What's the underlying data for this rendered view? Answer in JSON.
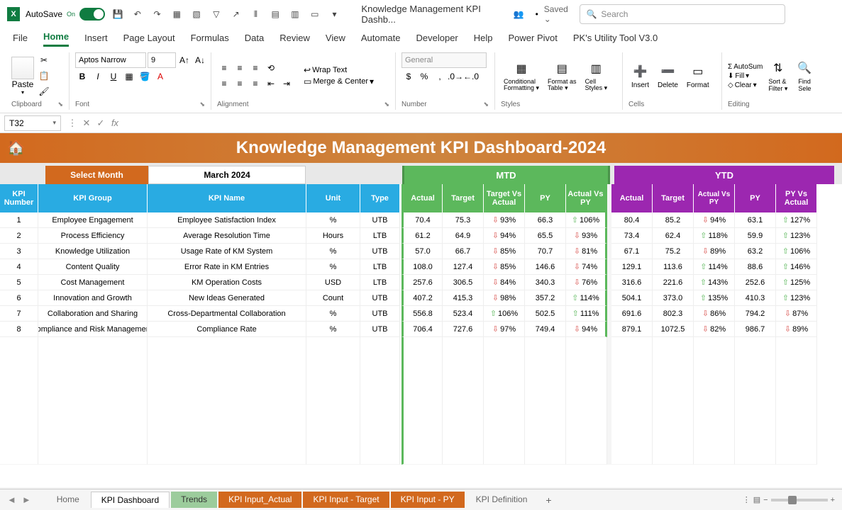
{
  "titlebar": {
    "autosave_label": "AutoSave",
    "autosave_state": "On",
    "doc_title": "Knowledge Management KPI Dashb...",
    "saved_status": "Saved",
    "search_placeholder": "Search"
  },
  "menu": {
    "tabs": [
      "File",
      "Home",
      "Insert",
      "Page Layout",
      "Formulas",
      "Data",
      "Review",
      "View",
      "Automate",
      "Developer",
      "Help",
      "Power Pivot",
      "PK's Utility Tool V3.0"
    ],
    "active": "Home"
  },
  "ribbon": {
    "clipboard": {
      "label": "Clipboard",
      "paste": "Paste"
    },
    "font": {
      "label": "Font",
      "name": "Aptos Narrow",
      "size": "9"
    },
    "alignment": {
      "label": "Alignment",
      "wrap": "Wrap Text",
      "merge": "Merge & Center"
    },
    "number": {
      "label": "Number",
      "format": "General"
    },
    "styles": {
      "label": "Styles",
      "cond": "Conditional Formatting",
      "table": "Format as Table",
      "cell": "Cell Styles"
    },
    "cells": {
      "label": "Cells",
      "insert": "Insert",
      "delete": "Delete",
      "format": "Format"
    },
    "editing": {
      "label": "Editing",
      "autosum": "AutoSum",
      "fill": "Fill",
      "clear": "Clear",
      "sort": "Sort & Filter",
      "find": "Find Sele"
    }
  },
  "formula_bar": {
    "cell_ref": "T32",
    "formula": ""
  },
  "dashboard": {
    "title": "Knowledge Management KPI Dashboard-2024",
    "select_month_label": "Select Month",
    "month_value": "March 2024",
    "mtd_label": "MTD",
    "ytd_label": "YTD",
    "headers": {
      "kpi_num": "KPI Number",
      "kpi_group": "KPI Group",
      "kpi_name": "KPI Name",
      "unit": "Unit",
      "type": "Type",
      "actual": "Actual",
      "target": "Target",
      "tva": "Target Vs Actual",
      "py": "PY",
      "avp": "Actual Vs PY",
      "pva": "PY Vs Actual"
    },
    "rows": [
      {
        "num": "1",
        "group": "Employee Engagement",
        "name": "Employee Satisfaction Index",
        "unit": "%",
        "type": "UTB",
        "m_actual": "70.4",
        "m_target": "75.3",
        "m_tva": "93%",
        "m_tva_dir": "down",
        "m_py": "66.3",
        "m_avp": "106%",
        "m_avp_dir": "up",
        "y_actual": "80.4",
        "y_target": "85.2",
        "y_tva": "94%",
        "y_tva_dir": "down",
        "y_py": "63.1",
        "y_pva": "127%",
        "y_pva_dir": "up"
      },
      {
        "num": "2",
        "group": "Process Efficiency",
        "name": "Average Resolution Time",
        "unit": "Hours",
        "type": "LTB",
        "m_actual": "61.2",
        "m_target": "64.9",
        "m_tva": "94%",
        "m_tva_dir": "down",
        "m_py": "65.5",
        "m_avp": "93%",
        "m_avp_dir": "down",
        "y_actual": "73.4",
        "y_target": "62.4",
        "y_tva": "118%",
        "y_tva_dir": "up",
        "y_py": "59.9",
        "y_pva": "123%",
        "y_pva_dir": "up"
      },
      {
        "num": "3",
        "group": "Knowledge Utilization",
        "name": "Usage Rate of KM System",
        "unit": "%",
        "type": "UTB",
        "m_actual": "57.0",
        "m_target": "66.7",
        "m_tva": "85%",
        "m_tva_dir": "down",
        "m_py": "70.7",
        "m_avp": "81%",
        "m_avp_dir": "down",
        "y_actual": "67.1",
        "y_target": "75.2",
        "y_tva": "89%",
        "y_tva_dir": "down",
        "y_py": "63.2",
        "y_pva": "106%",
        "y_pva_dir": "up"
      },
      {
        "num": "4",
        "group": "Content Quality",
        "name": "Error Rate in KM Entries",
        "unit": "%",
        "type": "LTB",
        "m_actual": "108.0",
        "m_target": "127.4",
        "m_tva": "85%",
        "m_tva_dir": "down",
        "m_py": "146.6",
        "m_avp": "74%",
        "m_avp_dir": "down",
        "y_actual": "129.1",
        "y_target": "113.6",
        "y_tva": "114%",
        "y_tva_dir": "up",
        "y_py": "88.6",
        "y_pva": "146%",
        "y_pva_dir": "up"
      },
      {
        "num": "5",
        "group": "Cost Management",
        "name": "KM Operation Costs",
        "unit": "USD",
        "type": "LTB",
        "m_actual": "257.6",
        "m_target": "306.5",
        "m_tva": "84%",
        "m_tva_dir": "down",
        "m_py": "340.3",
        "m_avp": "76%",
        "m_avp_dir": "down",
        "y_actual": "316.6",
        "y_target": "221.6",
        "y_tva": "143%",
        "y_tva_dir": "up",
        "y_py": "252.6",
        "y_pva": "125%",
        "y_pva_dir": "up"
      },
      {
        "num": "6",
        "group": "Innovation and Growth",
        "name": "New Ideas Generated",
        "unit": "Count",
        "type": "UTB",
        "m_actual": "407.2",
        "m_target": "415.3",
        "m_tva": "98%",
        "m_tva_dir": "down",
        "m_py": "357.2",
        "m_avp": "114%",
        "m_avp_dir": "up",
        "y_actual": "504.1",
        "y_target": "373.0",
        "y_tva": "135%",
        "y_tva_dir": "up",
        "y_py": "410.3",
        "y_pva": "123%",
        "y_pva_dir": "up"
      },
      {
        "num": "7",
        "group": "Collaboration and Sharing",
        "name": "Cross-Departmental Collaboration",
        "unit": "%",
        "type": "UTB",
        "m_actual": "556.8",
        "m_target": "523.4",
        "m_tva": "106%",
        "m_tva_dir": "up",
        "m_py": "502.5",
        "m_avp": "111%",
        "m_avp_dir": "up",
        "y_actual": "691.6",
        "y_target": "802.3",
        "y_tva": "86%",
        "y_tva_dir": "down",
        "y_py": "794.2",
        "y_pva": "87%",
        "y_pva_dir": "down"
      },
      {
        "num": "8",
        "group": "ompliance and Risk Managemer",
        "name": "Compliance Rate",
        "unit": "%",
        "type": "UTB",
        "m_actual": "706.4",
        "m_target": "727.6",
        "m_tva": "97%",
        "m_tva_dir": "down",
        "m_py": "749.4",
        "m_avp": "94%",
        "m_avp_dir": "down",
        "y_actual": "879.1",
        "y_target": "1072.5",
        "y_tva": "82%",
        "y_tva_dir": "down",
        "y_py": "986.7",
        "y_pva": "89%",
        "y_pva_dir": "down"
      }
    ]
  },
  "sheets": {
    "tabs": [
      {
        "label": "Home",
        "style": "plain"
      },
      {
        "label": "KPI Dashboard",
        "style": "white"
      },
      {
        "label": "Trends",
        "style": "green"
      },
      {
        "label": "KPI Input_Actual",
        "style": "orange"
      },
      {
        "label": "KPI Input - Target",
        "style": "orange"
      },
      {
        "label": "KPI Input - PY",
        "style": "orange"
      },
      {
        "label": "KPI Definition",
        "style": "plain"
      }
    ]
  }
}
